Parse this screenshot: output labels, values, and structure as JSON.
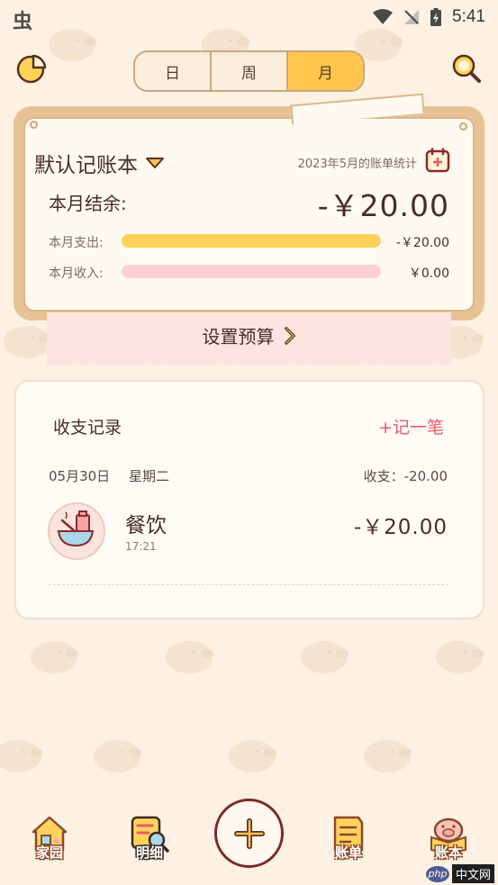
{
  "status_bar": {
    "app_icon": "虫",
    "time": "5:41",
    "icons": [
      "wifi-icon",
      "signal-off-icon",
      "battery-charging-icon"
    ]
  },
  "top_bar": {
    "left_icon": "pie-chart-icon",
    "right_icon": "search-icon",
    "segments": [
      {
        "label": "日",
        "active": false
      },
      {
        "label": "周",
        "active": false
      },
      {
        "label": "月",
        "active": true
      }
    ]
  },
  "summary": {
    "book_name": "默认记账本",
    "stat_label": "2023年5月的账单统计",
    "balance_label": "本月结余:",
    "balance_value": "-￥20.00",
    "expense_label": "本月支出:",
    "expense_value": "-￥20.00",
    "expense_fill": 1.0,
    "income_label": "本月收入:",
    "income_value": "￥0.00",
    "income_fill": 1.0
  },
  "budget": {
    "label": "设置预算"
  },
  "records": {
    "title": "收支记录",
    "add_label": "+记一笔",
    "days": [
      {
        "date": "05月30日",
        "weekday": "星期二",
        "summary": "收支：-20.00",
        "entries": [
          {
            "category": "餐饮",
            "time": "17:21",
            "amount": "-￥20.00",
            "icon": "food-bowl-icon"
          }
        ]
      }
    ]
  },
  "bottom_nav": {
    "items": [
      {
        "label": "家园",
        "icon": "home-icon",
        "active": false
      },
      {
        "label": "明细",
        "icon": "detail-search-icon",
        "active": true
      },
      {
        "label": "账单",
        "icon": "bill-icon",
        "active": false
      },
      {
        "label": "账本",
        "icon": "pig-book-icon",
        "active": false
      }
    ],
    "add_icon": "plus-icon"
  },
  "watermark": {
    "logo": "php",
    "text": "中文网"
  },
  "colors": {
    "background": "#fcf1e2",
    "accent_yellow": "#ffc54d",
    "expense_bar": "#ffd35a",
    "income_bar": "#ffd0d0",
    "add_red": "#e85a6a",
    "text_dark": "#4a2c26"
  }
}
